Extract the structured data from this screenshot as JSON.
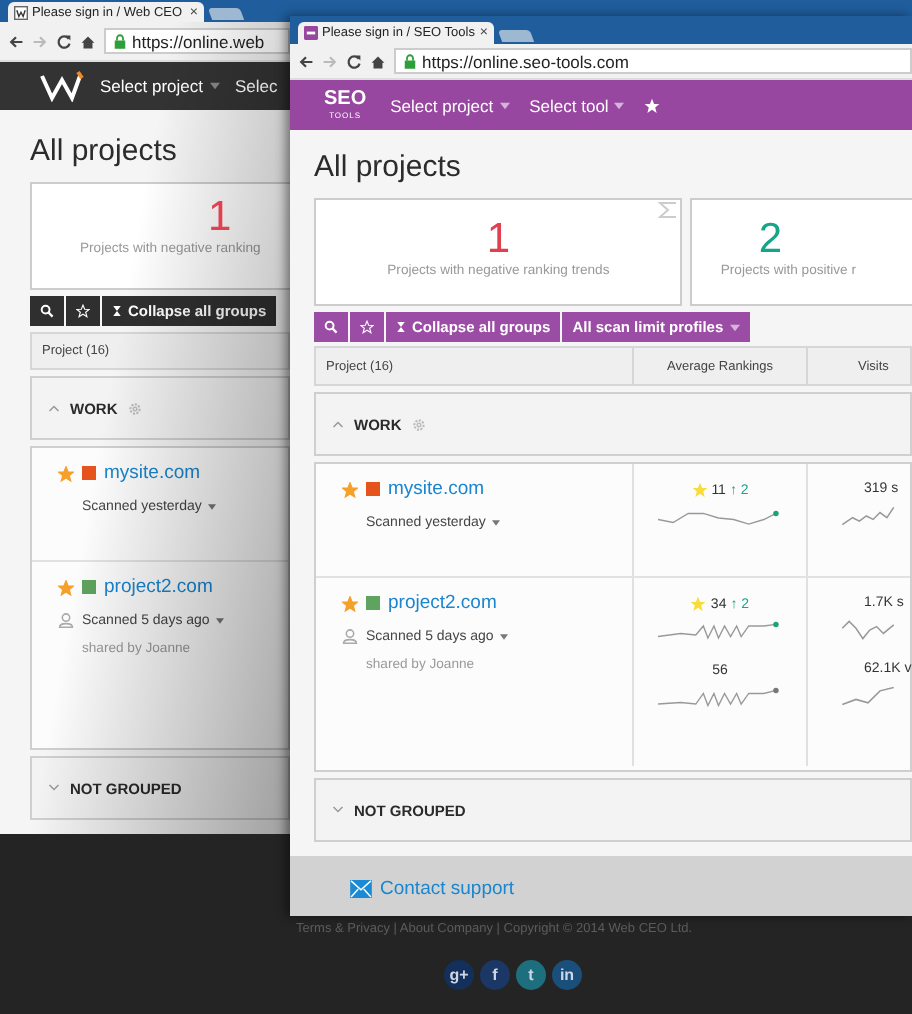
{
  "back_window": {
    "tab": {
      "title": "Please sign in / Web CEO",
      "close": "×"
    },
    "url": "https://online.web",
    "nav": [
      {
        "label": "Select project",
        "caret": true
      },
      {
        "label": "Selec",
        "caret": false
      }
    ],
    "title": "All projects",
    "cards": [
      {
        "value": "1",
        "label": "Projects with negative ranking",
        "color": "#e0404f"
      }
    ],
    "toolbar": [
      {
        "label": "Collapse all groups"
      }
    ],
    "columns": [
      "Project (16)"
    ],
    "groups": [
      {
        "name": "WORK",
        "expanded": true,
        "projects": [
          {
            "name": "mysite.com",
            "starred": true,
            "color": "#e4541c",
            "status": "Scanned yesterday"
          },
          {
            "name": "project2.com",
            "starred": true,
            "color": "#5ea35e",
            "status": "Scanned 5 days ago",
            "shared_by": "shared by Joanne"
          }
        ]
      },
      {
        "name": "NOT GROUPED",
        "expanded": false
      }
    ],
    "footer": {
      "links": "Terms & Privacy | About Company | Copyright © 2014 Web CEO Ltd.",
      "social": [
        "g+",
        "f",
        "t",
        "in"
      ]
    }
  },
  "front_window": {
    "tab": {
      "title": "Please sign in / SEO Tools",
      "close": "×"
    },
    "url": "https://online.seo-tools.com",
    "logo": {
      "text": "SEO",
      "subtext": "TOOLS"
    },
    "nav": [
      {
        "label": "Select project",
        "caret": true
      },
      {
        "label": "Select tool",
        "caret": true
      }
    ],
    "title": "All projects",
    "cards": [
      {
        "value": "1",
        "label": "Projects with negative ranking trends",
        "color": "#e0404f"
      },
      {
        "value": "2",
        "label": "Projects with positive r",
        "color": "#17a589"
      }
    ],
    "toolbar": [
      {
        "label": "Collapse all groups"
      },
      {
        "label": "All scan limit profiles"
      }
    ],
    "columns": [
      "Project (16)",
      "Average Rankings",
      "Visits"
    ],
    "groups": [
      {
        "name": "WORK",
        "expanded": true,
        "projects": [
          {
            "name": "mysite.com",
            "starred": true,
            "color": "#e4541c",
            "status": "Scanned yesterday",
            "metrics": [
              {
                "rank": "11",
                "change": "↑ 2",
                "visits": "319 s",
                "color": "#1aa37a"
              }
            ]
          },
          {
            "name": "project2.com",
            "starred": true,
            "color": "#5ea35e",
            "status": "Scanned 5 days ago",
            "shared_by": "shared by Joanne",
            "metrics": [
              {
                "rank": "34",
                "change": "↑ 2",
                "visits": "1.7K s",
                "color": "#1aa37a"
              },
              {
                "rank": "56",
                "visits": "62.1K v",
                "color": "#777777"
              }
            ]
          }
        ]
      },
      {
        "name": "NOT GROUPED",
        "expanded": false
      }
    ],
    "contact": "Contact support"
  }
}
